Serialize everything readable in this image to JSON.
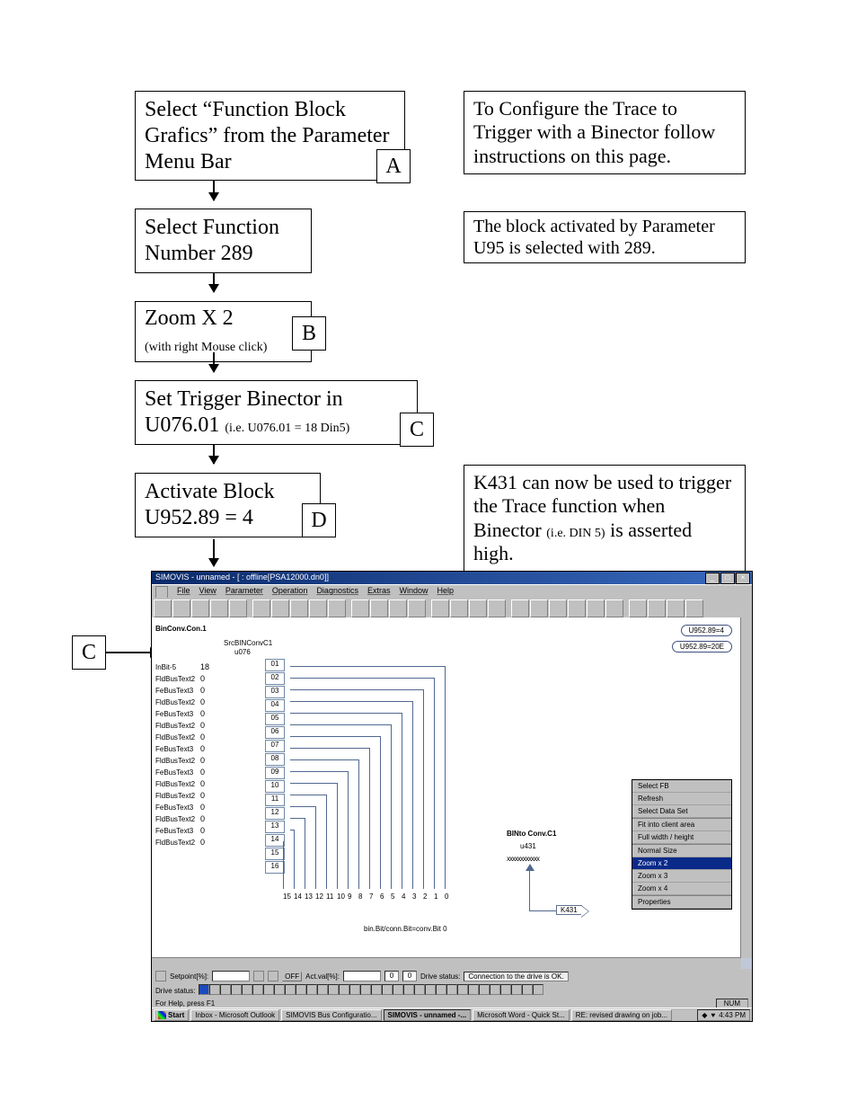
{
  "boxes": {
    "step1": "Select “Function Block Grafics” from the Parameter Menu Bar",
    "step2": "Select Function Number 289",
    "step3_main": "Zoom X 2",
    "step3_sub": "(with right Mouse click)",
    "step4_main": "Set Trigger Binector in U076.01 ",
    "step4_sub": "(i.e. U076.01 = 18 Din5)",
    "step5_l1": "Activate Block",
    "step5_l2": "U952.89 = 4",
    "note1": "To Configure the Trace to Trigger with a Binector follow instructions on this page.",
    "note2": "The block activated by Parameter U95        is selected with 289.",
    "note3_a": "K431 can now be used to trigger the Trace function when Binector ",
    "note3_b": "(i.e. DIN 5)",
    "note3_c": " is asserted high."
  },
  "labels": {
    "A": "A",
    "B": "B",
    "C": "C",
    "D": "D"
  },
  "screenshot": {
    "title": "SIMOVIS - unnamed  -  [  : offline[PSA12000.dn0]]",
    "menu": [
      "File",
      "View",
      "Parameter",
      "Operation",
      "Diagnostics",
      "Extras",
      "Window",
      "Help"
    ],
    "pill1": "U952.89=4",
    "pill2": "U952.89=20E",
    "blocktitle": "BinConv.Con.1",
    "subheader": "SrcBINConvC1",
    "subheader2": "u076",
    "io_labels": [
      "InBit-5",
      "FldBusText2",
      "FeBusText3",
      "FldBusText2",
      "FeBusText3",
      "FldBusText2",
      "FldBusText2",
      "FeBusText3",
      "FldBusText2",
      "FeBusText3",
      "FldBusText2",
      "FldBusText2",
      "FeBusText3",
      "FldBusText2",
      "FeBusText3",
      "FldBusText2"
    ],
    "io_vals": [
      "18",
      "0",
      "0",
      "0",
      "0",
      "0",
      "0",
      "0",
      "0",
      "0",
      "0",
      "0",
      "0",
      "0",
      "0",
      "0"
    ],
    "numcells": [
      "01",
      "02",
      "03",
      "04",
      "05",
      "06",
      "07",
      "08",
      "09",
      "10",
      "11",
      "12",
      "13",
      "14",
      "15",
      "16"
    ],
    "botnums": [
      "15",
      "14",
      "13",
      "12",
      "11",
      "10",
      "9",
      "8",
      "7",
      "6",
      "5",
      "4",
      "3",
      "2",
      "1",
      "0"
    ],
    "outlabel1": "BINto Conv.C1",
    "outlabel2": "u431",
    "outlabel3": "xxxxxxxxxxxx",
    "bottext": "bin.Bit/conn.Bit=conv.Bit 0",
    "k431": "K431",
    "ctxmenu": [
      "Select FB",
      "Refresh",
      "Select Data Set",
      "Fit into client area",
      "Full width / height",
      "Normal Size",
      "Zoom x 2",
      "Zoom x 3",
      "Zoom x 4",
      "Properties"
    ],
    "status_setpoint": "Setpoint[%]:",
    "status_off": "OFF",
    "status_actval": "Act.val[%]:",
    "status_drive": "Drive status:",
    "status_conn": "Connection to the drive is OK.",
    "status_drive2": "Drive status:",
    "help": "For Help, press F1",
    "num": "NUM",
    "task_start": "Start",
    "task_items": [
      "Inbox - Microsoft Outlook",
      "SIMOVIS Bus Configuratio...",
      "SIMOVIS - unnamed  -...",
      "Microsoft Word - Quick St...",
      "RE: revised drawing on job..."
    ],
    "clock": "4:43 PM"
  }
}
